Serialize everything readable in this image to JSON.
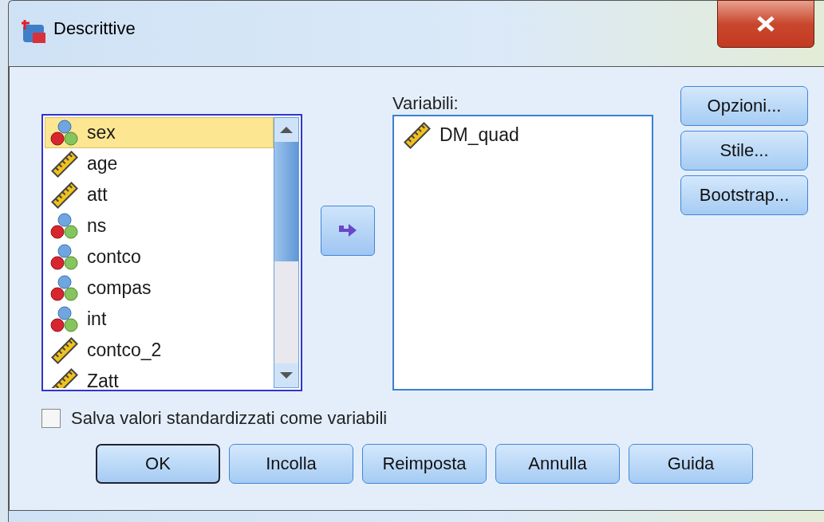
{
  "window": {
    "title": "Descrittive"
  },
  "source_list": {
    "items": [
      {
        "name": "sex",
        "kind": "nominal",
        "selected": true
      },
      {
        "name": "age",
        "kind": "scale",
        "selected": false
      },
      {
        "name": "att",
        "kind": "scale",
        "selected": false
      },
      {
        "name": "ns",
        "kind": "nominal",
        "selected": false
      },
      {
        "name": "contco",
        "kind": "nominal",
        "selected": false
      },
      {
        "name": "compas",
        "kind": "nominal",
        "selected": false
      },
      {
        "name": "int",
        "kind": "nominal",
        "selected": false
      },
      {
        "name": "contco_2",
        "kind": "scale",
        "selected": false
      },
      {
        "name": "Zatt",
        "kind": "scale",
        "selected": false
      }
    ]
  },
  "target": {
    "label": "Variabili:",
    "items": [
      {
        "name": "DM_quad",
        "kind": "scale",
        "selected": false
      }
    ]
  },
  "side_buttons": [
    "Opzioni...",
    "Stile...",
    "Bootstrap..."
  ],
  "checkbox": {
    "label": "Salva valori standardizzati come variabili",
    "checked": false
  },
  "buttons": [
    {
      "label": "OK",
      "default": true
    },
    {
      "label": "Incolla",
      "default": false
    },
    {
      "label": "Reimposta",
      "default": false
    },
    {
      "label": "Annulla",
      "default": false
    },
    {
      "label": "Guida",
      "default": false
    }
  ]
}
